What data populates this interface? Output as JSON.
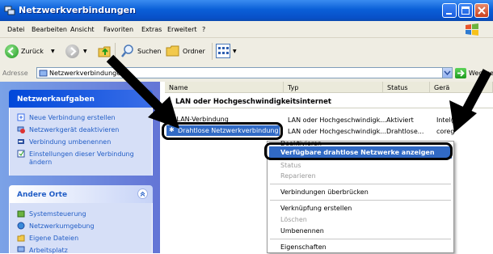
{
  "window": {
    "title": "Netzwerkverbindungen"
  },
  "menubar": {
    "items": [
      "Datei",
      "Bearbeiten",
      "Ansicht",
      "Favoriten",
      "Extras",
      "Erweitert",
      "?"
    ]
  },
  "toolbar": {
    "back_label": "Zurück",
    "search_label": "Suchen",
    "folder_label": "Ordner"
  },
  "address": {
    "label": "Adresse",
    "value": "Netzwerkverbindunge",
    "go_label": "Wechseln zu"
  },
  "left_panel": {
    "tasks_title": "Netzwerkaufgaben",
    "tasks": [
      "Neue Verbindung erstellen",
      "Netzwerkgerät deaktivieren",
      "Verbindung umbenennen",
      "Einstellungen dieser Verbindung",
      "ändern"
    ],
    "places_title": "Andere Orte",
    "places": [
      "Systemsteuerung",
      "Netzwerkumgebung",
      "Eigene Dateien",
      "Arbeitsplatz"
    ]
  },
  "columns": [
    "Name",
    "Typ",
    "Status",
    "Gerä"
  ],
  "group_title": "LAN oder Hochgeschwindigkeitsinternet",
  "rows": [
    {
      "name": "LAN-Verbindung",
      "type": "LAN oder Hochgeschwindigk...",
      "status": "Aktiviert",
      "device": "Intel("
    },
    {
      "name": "Drahtlose Netzwerkverbindung",
      "type": "LAN oder Hochgeschwindigk...",
      "status": "Drahtlose...",
      "device": "coreg"
    }
  ],
  "context_menu": {
    "partial_top": "Deaktivieren",
    "highlighted": "Verfügbare drahtlose Netzwerke anzeigen",
    "items": [
      {
        "label": "Status",
        "disabled": true
      },
      {
        "label": "Reparieren",
        "disabled": true
      },
      {
        "label": "Verbindungen überbrücken",
        "disabled": false
      },
      {
        "label": "Verknüpfung erstellen",
        "disabled": false
      },
      {
        "label": "Löschen",
        "disabled": true
      },
      {
        "label": "Umbenennen",
        "disabled": false
      },
      {
        "label": "Eigenschaften",
        "disabled": false
      }
    ]
  },
  "colors": {
    "titlebar": "#0a5fd8",
    "panel_gradient": "#6375d6",
    "selection": "#316ac5",
    "link": "#215dc6"
  }
}
